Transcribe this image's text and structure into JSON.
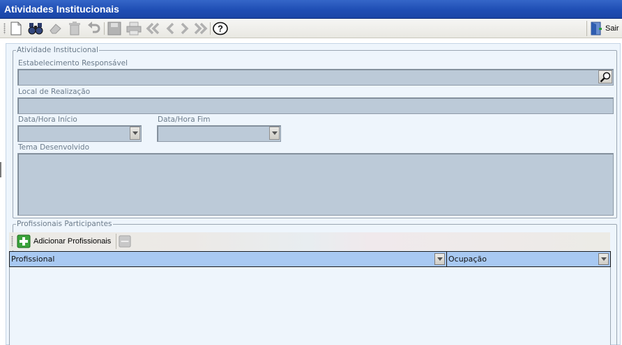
{
  "window": {
    "title": "Atividades Institucionais"
  },
  "toolbar": {
    "buttons": [
      {
        "icon": "new-document-icon"
      },
      {
        "icon": "binoculars-search-icon"
      },
      {
        "icon": "eraser-icon"
      },
      {
        "icon": "trash-icon"
      },
      {
        "icon": "undo-icon"
      },
      {
        "icon": "save-disk-icon"
      },
      {
        "icon": "printer-icon"
      },
      {
        "icon": "first-record-icon"
      },
      {
        "icon": "previous-record-icon"
      },
      {
        "icon": "next-record-icon"
      },
      {
        "icon": "last-record-icon"
      },
      {
        "icon": "help-icon"
      }
    ],
    "exit_label": "Sair"
  },
  "activity": {
    "legend": "Atividade Institucional",
    "establishment_label": "Estabelecimento Responsável",
    "establishment_value": "",
    "location_label": "Local de Realização",
    "location_value": "",
    "start_label": "Data/Hora Início",
    "start_value": "",
    "end_label": "Data/Hora Fim",
    "end_value": "",
    "theme_label": "Tema Desenvolvido",
    "theme_value": ""
  },
  "professionals": {
    "legend": "Profissionais Participantes",
    "add_label": "Adicionar Profissionais",
    "columns": [
      "Profissional",
      "Ocupação"
    ],
    "rows": []
  },
  "colors": {
    "title_bar": "#1f4eb4",
    "input_fill": "#bccad8",
    "grid_header": "#a8c9f2",
    "panel_bg": "#eef5fc"
  }
}
